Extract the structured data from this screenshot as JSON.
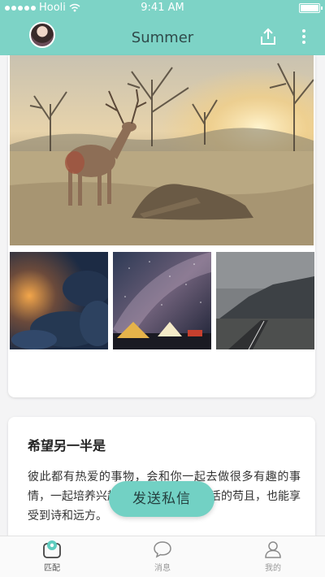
{
  "status_bar": {
    "carrier": "Hooli",
    "time": "9:41 AM"
  },
  "header": {
    "title": "Summer"
  },
  "about": {
    "heading": "希望另一半是",
    "text": "彼此都有热爱的事物，会和你一起去做很多有趣的事情，一起培养兴趣爱好，一起面对生活的苟且，也能享受到诗和远方。"
  },
  "action": {
    "send_message_label": "发送私信"
  },
  "tabs": [
    {
      "label": "匹配",
      "icon": "match-icon",
      "active": true
    },
    {
      "label": "消息",
      "icon": "message-icon",
      "active": false
    },
    {
      "label": "我的",
      "icon": "profile-icon",
      "active": false
    }
  ],
  "colors": {
    "accent": "#7dd3c6",
    "button": "#72d1c4"
  }
}
